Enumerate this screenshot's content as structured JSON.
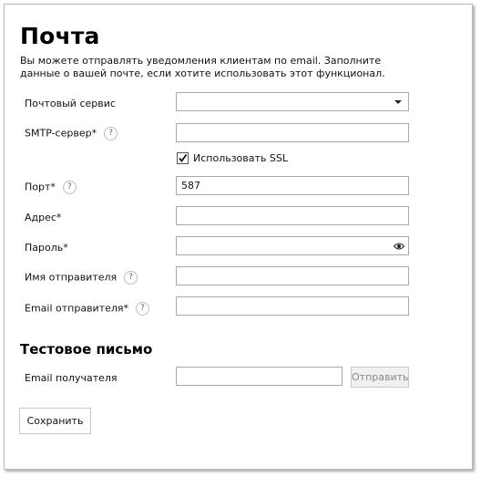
{
  "page": {
    "title": "Почта",
    "description": "Вы можете отправлять уведомления клиентам по email. Заполните данные о вашей почте, если хотите использовать этот функционал."
  },
  "form": {
    "mail_service": {
      "label": "Почтовый сервис",
      "value": ""
    },
    "smtp_server": {
      "label": "SMTP-сервер*",
      "value": "",
      "help": "?"
    },
    "use_ssl": {
      "label": "Использовать SSL",
      "checked": true
    },
    "port": {
      "label": "Порт*",
      "value": "587",
      "help": "?"
    },
    "address": {
      "label": "Адрес*",
      "value": ""
    },
    "password": {
      "label": "Пароль*",
      "value": ""
    },
    "sender_name": {
      "label": "Имя отправителя",
      "value": "",
      "help": "?"
    },
    "sender_email": {
      "label": "Email отправителя*",
      "value": "",
      "help": "?"
    }
  },
  "test_email": {
    "title": "Тестовое письмо",
    "recipient_label": "Email получателя",
    "recipient_value": "",
    "send_label": "Отправить"
  },
  "save_label": "Сохранить",
  "icons": {
    "dropdown": "chevron-down-icon",
    "checkbox": "checkmark-icon",
    "password_toggle": "eye-icon",
    "help": "question-icon"
  }
}
